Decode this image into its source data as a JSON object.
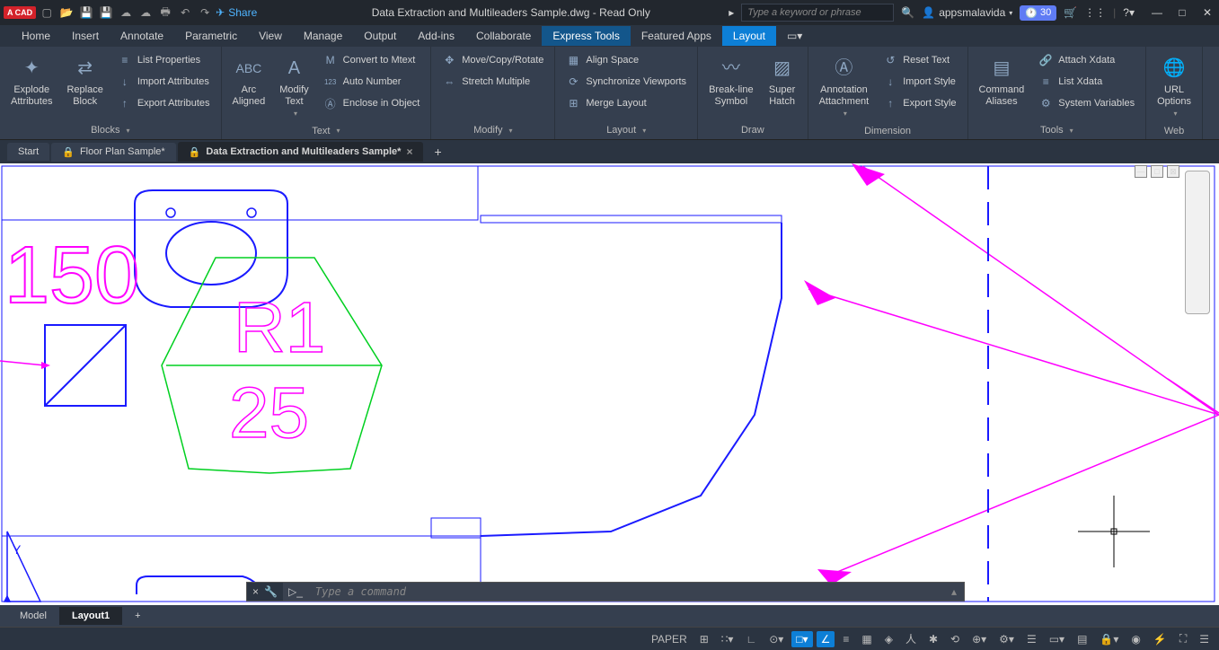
{
  "title": "Data Extraction and Multileaders Sample.dwg - Read Only",
  "share": "Share",
  "search_placeholder": "Type a keyword or phrase",
  "username": "appsmalavida",
  "trial_badge": "30",
  "menu": [
    "Home",
    "Insert",
    "Annotate",
    "Parametric",
    "View",
    "Manage",
    "Output",
    "Add-ins",
    "Collaborate",
    "Express Tools",
    "Featured Apps",
    "Layout"
  ],
  "active_menu": "Express Tools",
  "ribbon": {
    "blocks": {
      "title": "Blocks",
      "explode": "Explode\nAttributes",
      "replace": "Replace\nBlock",
      "list_props": "List Properties",
      "import_attr": "Import Attributes",
      "export_attr": "Export Attributes"
    },
    "text": {
      "title": "Text",
      "arc": "Arc\nAligned",
      "modify": "Modify\nText",
      "convert": "Convert to Mtext",
      "auto": "Auto Number",
      "enclose": "Enclose in Object"
    },
    "modify": {
      "title": "Modify",
      "move": "Move/Copy/Rotate",
      "stretch": "Stretch Multiple"
    },
    "layout": {
      "title": "Layout",
      "align": "Align Space",
      "sync": "Synchronize Viewports",
      "merge": "Merge Layout"
    },
    "draw": {
      "title": "Draw",
      "breakline": "Break-line\nSymbol",
      "hatch": "Super\nHatch"
    },
    "dimension": {
      "title": "Dimension",
      "annot": "Annotation\nAttachment",
      "reset": "Reset Text",
      "import": "Import Style",
      "export": "Export Style"
    },
    "tools": {
      "title": "Tools",
      "cmd": "Command\nAliases",
      "attach": "Attach Xdata",
      "list": "List Xdata",
      "sysvar": "System Variables"
    },
    "web": {
      "title": "Web",
      "url": "URL\nOptions"
    }
  },
  "doc_tabs": {
    "start": "Start",
    "floor": "Floor Plan Sample*",
    "data": "Data Extraction and Multileaders Sample*"
  },
  "drawing": {
    "label_150": "150",
    "label_r1": "R1",
    "label_25": "25"
  },
  "cmd_placeholder": "Type a command",
  "layout_tabs": {
    "model": "Model",
    "layout1": "Layout1"
  },
  "status": {
    "paper": "PAPER"
  }
}
